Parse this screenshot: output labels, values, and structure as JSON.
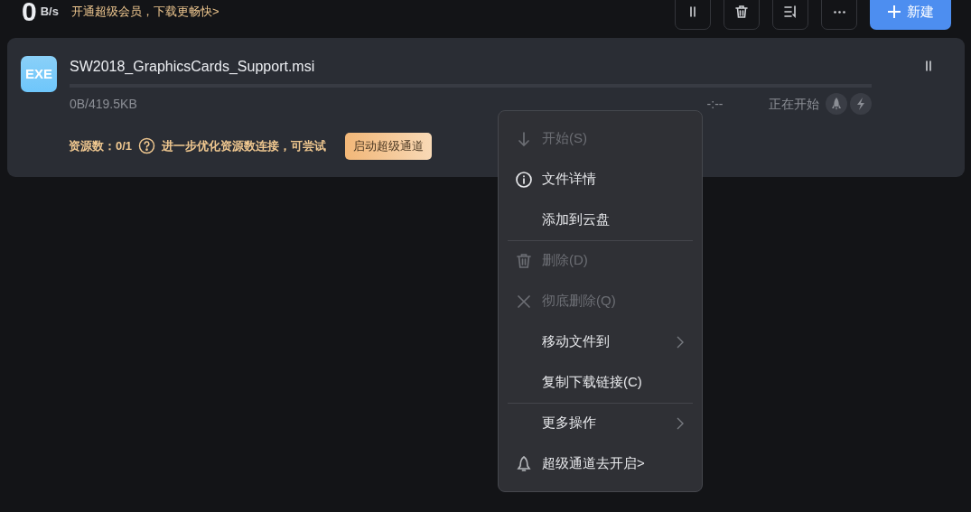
{
  "header": {
    "speed": "0",
    "speed_unit": "B/s",
    "promo": "开通超级会员，下载更畅快>",
    "toolbar": [
      {
        "kind": "pause"
      },
      {
        "kind": "trash"
      },
      {
        "kind": "sort"
      },
      {
        "kind": "more"
      }
    ],
    "new_button": "新建"
  },
  "task": {
    "file_type": "EXE",
    "name": "SW2018_GraphicsCards_Support.msi",
    "level": 0,
    "size": "0B/419.5KB",
    "time": "-:--",
    "status": "正在开始",
    "sources": "资源数：0/1",
    "hint": "进一步优化资源数连接，可尝试",
    "boost_button": "启动超级通道"
  },
  "context_menu": [
    {
      "kind": "arrow-down",
      "label": "开始(S)",
      "disabled": true,
      "submenu": false,
      "separator_before": false
    },
    {
      "kind": "info",
      "label": "文件详情",
      "disabled": false,
      "submenu": false,
      "separator_before": false
    },
    {
      "kind": "plain",
      "label": "添加到云盘",
      "disabled": false,
      "submenu": false,
      "separator_before": false
    },
    {
      "kind": "trash",
      "label": "删除(D)",
      "disabled": true,
      "submenu": false,
      "separator_before": true
    },
    {
      "kind": "close",
      "label": "彻底删除(Q)",
      "disabled": true,
      "submenu": false,
      "separator_before": false
    },
    {
      "kind": "plain",
      "label": "移动文件到",
      "disabled": false,
      "submenu": true,
      "separator_before": false
    },
    {
      "kind": "plain",
      "label": "复制下载链接(C)",
      "disabled": false,
      "submenu": false,
      "separator_before": false
    },
    {
      "kind": "plain",
      "label": "更多操作",
      "disabled": false,
      "submenu": true,
      "separator_before": true
    },
    {
      "kind": "bell",
      "label": "超级通道去开启>",
      "disabled": false,
      "submenu": false,
      "separator_before": false
    }
  ]
}
